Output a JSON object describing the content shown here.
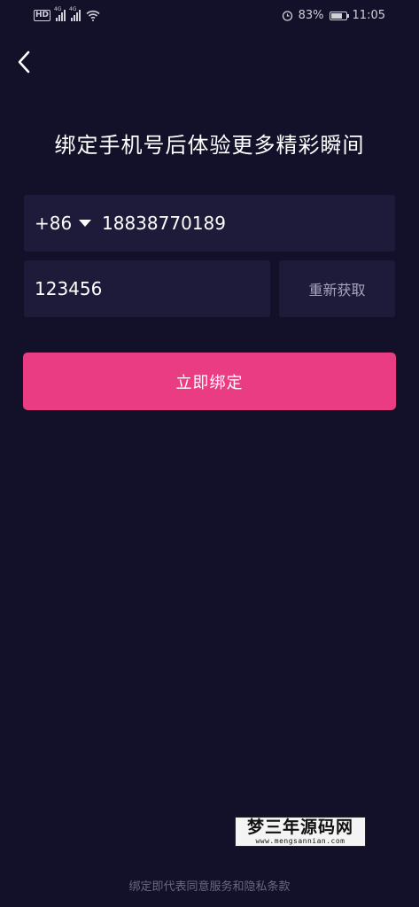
{
  "status_bar": {
    "hd": "HD",
    "network_1": "4G",
    "network_2": "4G",
    "battery_percent": "83%",
    "battery_level": 0.83,
    "time": "11:05"
  },
  "header": {
    "back_icon": "chevron-left-icon"
  },
  "title": "绑定手机号后体验更多精彩瞬间",
  "phone": {
    "country_code": "+86",
    "number": "18838770189"
  },
  "code": {
    "value": "123456",
    "resend_label": "重新获取"
  },
  "bind_button": "立即绑定",
  "watermark": {
    "main": "梦三年源码网",
    "sub": "www.mengsannian.com"
  },
  "terms": "绑定即代表同意服务和隐私条款",
  "colors": {
    "background": "#131129",
    "field": "#1d1a3a",
    "accent": "#ea3c82"
  }
}
